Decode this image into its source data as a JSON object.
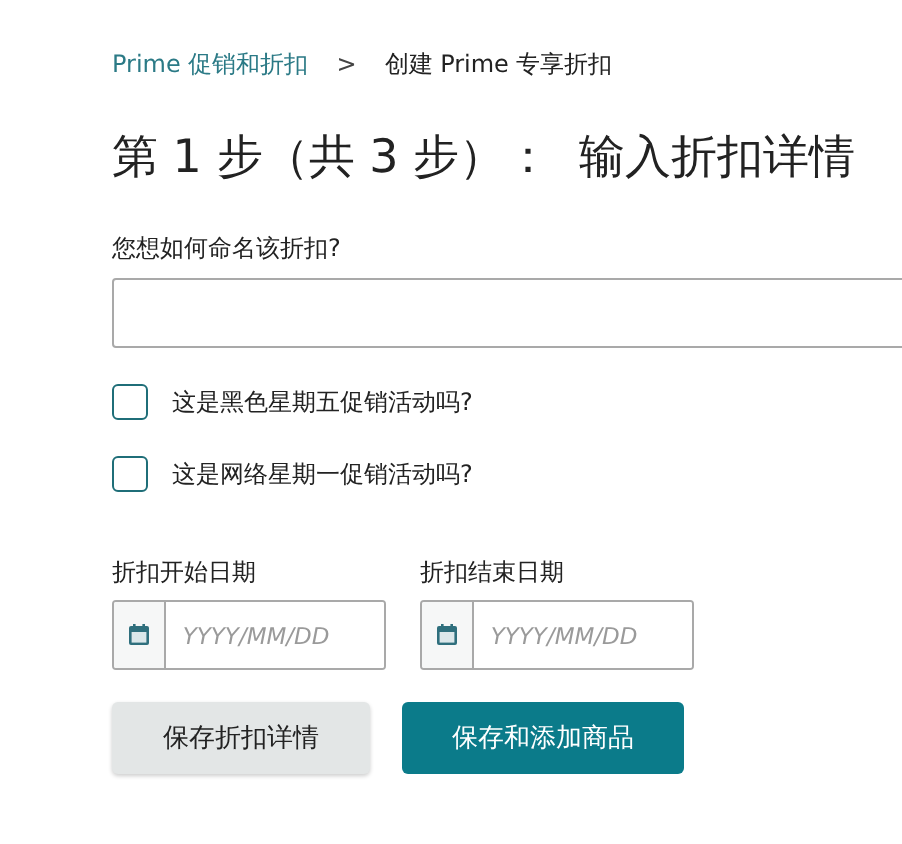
{
  "breadcrumb": [
    {
      "label": "Prime 促销和折扣",
      "kind": "link"
    },
    {
      "label": ">",
      "kind": "separator"
    },
    {
      "label": "创建 Prime 专享折扣",
      "kind": "current"
    }
  ],
  "heading": {
    "step": "第 1 步（共 3 步）：",
    "title": "输入折扣详情"
  },
  "name_field": {
    "label": "您想如何命名该折扣?"
  },
  "checkboxes": [
    {
      "label": "这是黑色星期五促销活动吗?",
      "checked": false
    },
    {
      "label": "这是网络星期一促销活动吗?",
      "checked": false
    }
  ],
  "date_fields": [
    {
      "label": "折扣开始日期",
      "placeholder": "YYYY/MM/DD"
    },
    {
      "label": "折扣结束日期",
      "placeholder": "YYYY/MM/DD"
    }
  ],
  "buttons": [
    {
      "label": "保存折扣详情",
      "kind": "secondary"
    },
    {
      "label": "保存和添加商品",
      "kind": "primary"
    }
  ]
}
